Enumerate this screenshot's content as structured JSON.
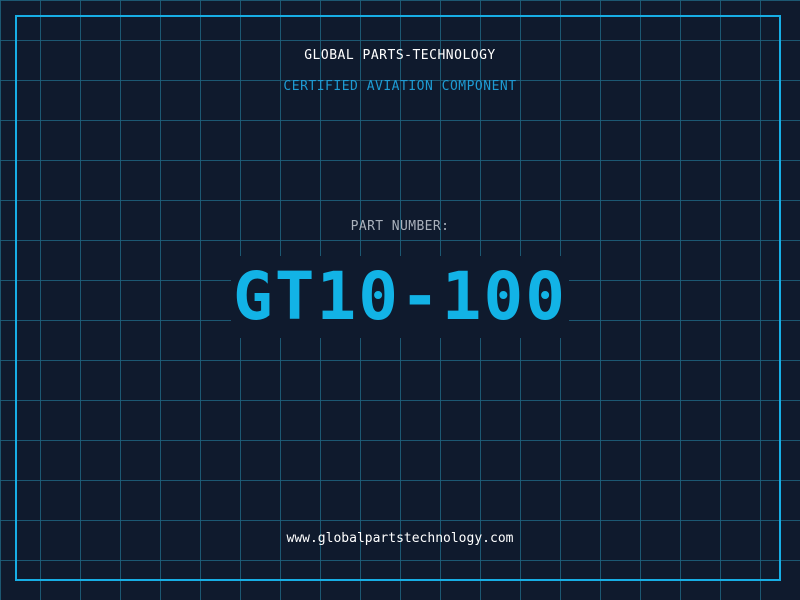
{
  "company": "GLOBAL PARTS-TECHNOLOGY",
  "subtitle": "CERTIFIED AVIATION COMPONENT",
  "part_label": "PART NUMBER:",
  "part_number": "GT10-100",
  "website": "www.globalpartstechnology.com",
  "colors": {
    "background": "#0f1a2d",
    "grid": "#1e627e",
    "frame": "#17aee5",
    "accent": "#12b3e6",
    "subtitle": "#1e9bd3",
    "text": "#ffffff",
    "muted_text": "#aab1bc"
  }
}
